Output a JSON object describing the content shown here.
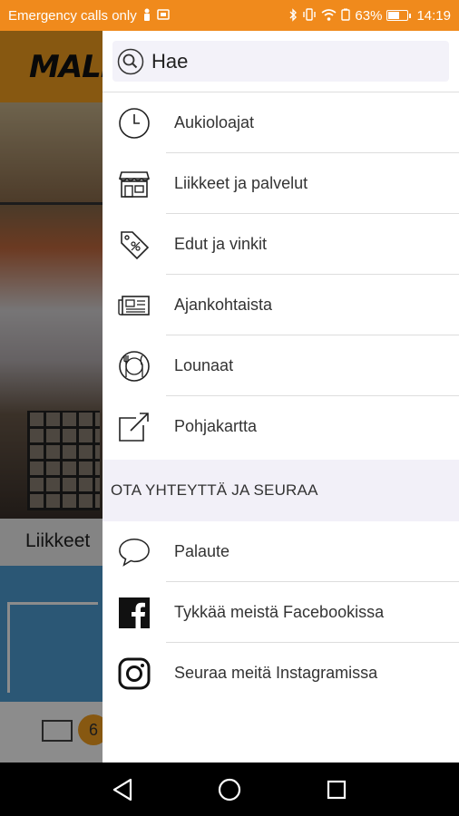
{
  "status_bar": {
    "carrier": "Emergency calls only",
    "battery_percent": "63%",
    "battery_level": 0.63,
    "time": "14:19"
  },
  "background": {
    "logo_text": "MALL",
    "label": "Liikkeet",
    "badge_count": "6",
    "accent_color": "#f6a01f"
  },
  "drawer": {
    "search": {
      "placeholder": "Hae"
    },
    "items": [
      {
        "label": "Aukioloajat",
        "icon": "clock-icon"
      },
      {
        "label": "Liikkeet ja palvelut",
        "icon": "store-icon"
      },
      {
        "label": "Edut ja vinkit",
        "icon": "tag-icon"
      },
      {
        "label": "Ajankohtaista",
        "icon": "newspaper-icon"
      },
      {
        "label": "Lounaat",
        "icon": "plate-cutlery-icon"
      },
      {
        "label": "Pohjakartta",
        "icon": "external-link-icon"
      }
    ],
    "section_header": "OTA YHTEYTTÄ JA SEURAA",
    "social": [
      {
        "label": "Palaute",
        "icon": "speech-bubble-icon"
      },
      {
        "label": "Tykkää meistä Facebookissa",
        "icon": "facebook-icon"
      },
      {
        "label": "Seuraa meitä Instagramissa",
        "icon": "instagram-icon"
      }
    ]
  },
  "nav_bar": {
    "back": "back-icon",
    "home": "home-icon",
    "recents": "recents-icon"
  },
  "colors": {
    "status_bar": "#f08a1c",
    "section_bg": "#f2f0f8",
    "search_bg": "#f3f2f9"
  }
}
